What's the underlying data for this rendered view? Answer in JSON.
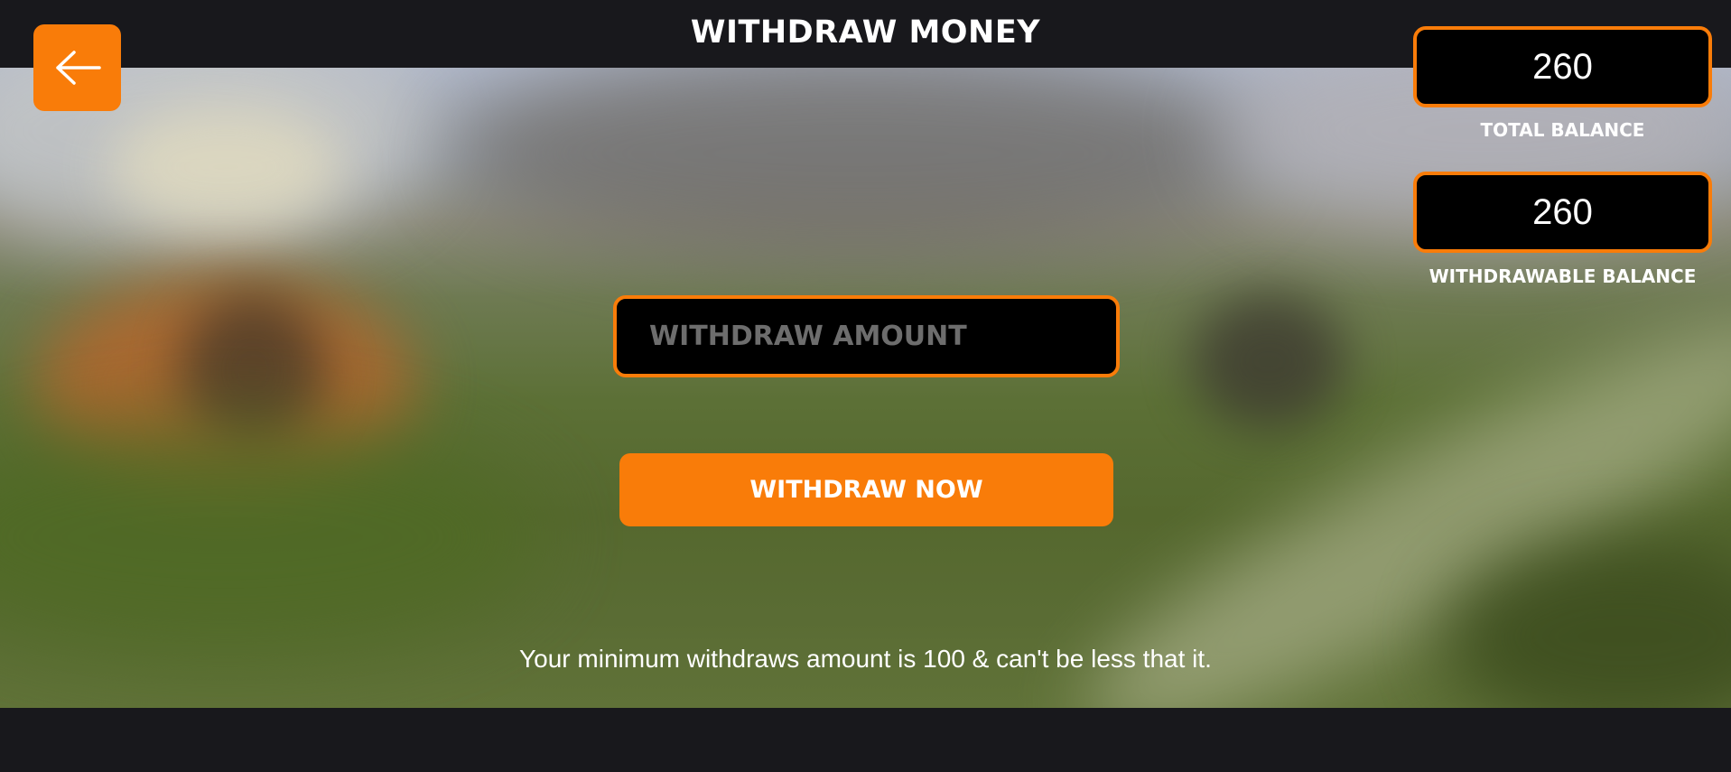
{
  "header": {
    "title": "WITHDRAW MONEY",
    "back_icon": "arrow-left-icon"
  },
  "balances": {
    "total": {
      "value": "260",
      "label": "TOTAL BALANCE"
    },
    "withdrawable": {
      "value": "260",
      "label": "WITHDRAWABLE BALANCE"
    }
  },
  "form": {
    "amount_placeholder": "WITHDRAW AMOUNT",
    "amount_value": "",
    "submit_label": "WITHDRAW NOW"
  },
  "note": "Your minimum withdraws amount is 100 & can't be less that it.",
  "colors": {
    "accent": "#f97c09",
    "bar_background": "#18181c",
    "field_background": "#000000",
    "text": "#ffffff"
  }
}
